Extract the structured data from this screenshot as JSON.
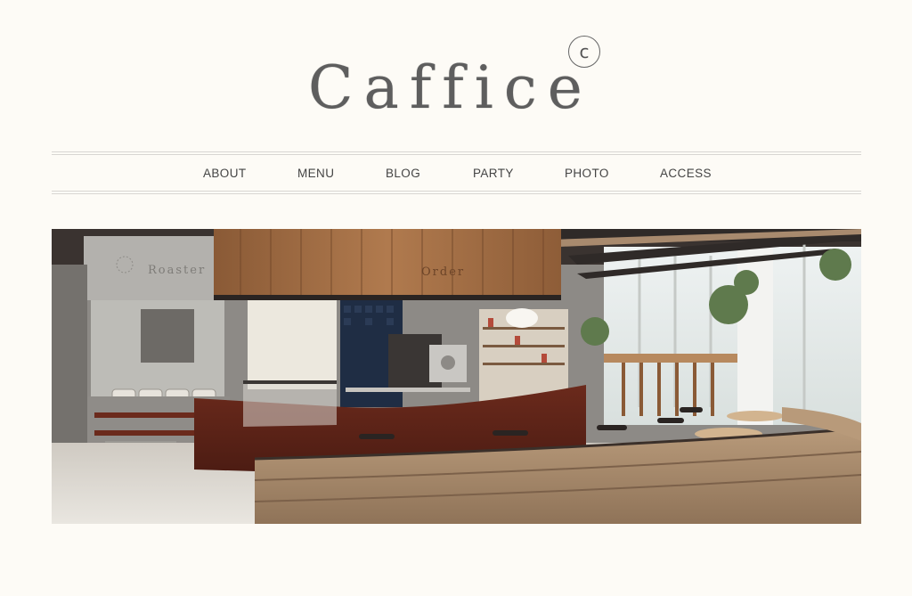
{
  "brand": {
    "name": "Caffice",
    "mark": "c"
  },
  "nav": {
    "items": [
      {
        "label": "ABOUT"
      },
      {
        "label": "MENU"
      },
      {
        "label": "BLOG"
      },
      {
        "label": "PARTY"
      },
      {
        "label": "PHOTO"
      },
      {
        "label": "ACCESS"
      }
    ]
  },
  "hero": {
    "signs": {
      "roaster": "Roaster",
      "order": "Order"
    }
  }
}
